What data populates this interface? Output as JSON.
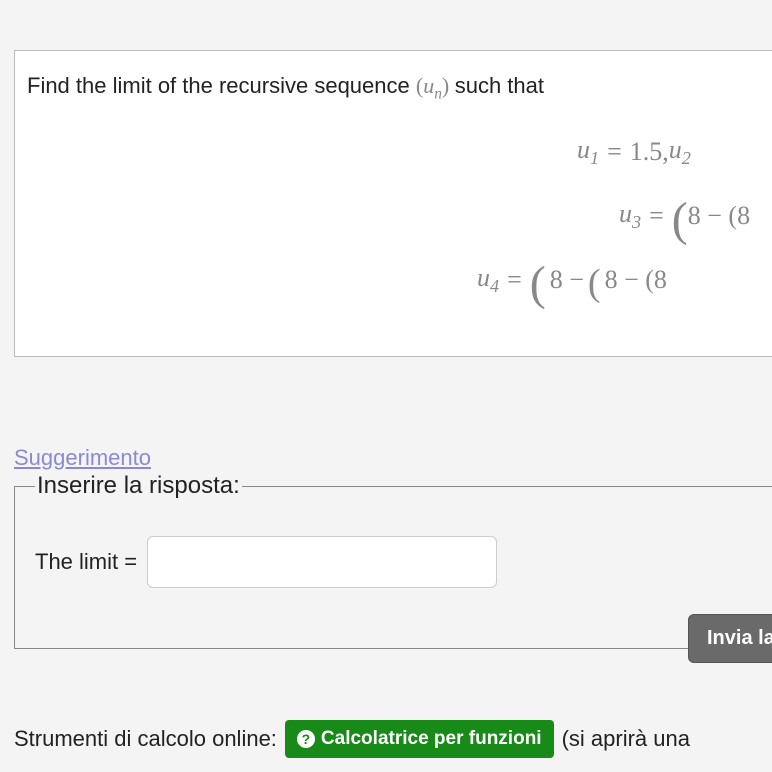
{
  "problem": {
    "intro_prefix": "Find the limit of the recursive sequence ",
    "seq_symbol": "(u",
    "seq_sub": "n",
    "seq_close": ")",
    "intro_suffix": " such that",
    "eq1_lhs_u": "u",
    "eq1_lhs_sub": "1",
    "eq1_eq": " = ",
    "eq1_val": "1.5",
    "eq1_sep": " ,  ",
    "eq1b_u": "u",
    "eq1b_sub": "2",
    "eq2_u": "u",
    "eq2_sub": "3",
    "eq2_eq": " = ",
    "eq2_rhs": "8 − (8",
    "eq3_u": "u",
    "eq3_sub": "4",
    "eq3_eq": " = ",
    "eq3_rhs_a": "8 − ",
    "eq3_rhs_b": "8 − (8 "
  },
  "hint": "Suggerimento",
  "answer": {
    "legend": "Inserire la risposta:",
    "label": "The limit =",
    "placeholder": ""
  },
  "submit": "Invia la",
  "tools": {
    "label": "Strumenti di calcolo online: ",
    "calc": "Calcolatrice per funzioni",
    "after": "(si aprirà una"
  }
}
